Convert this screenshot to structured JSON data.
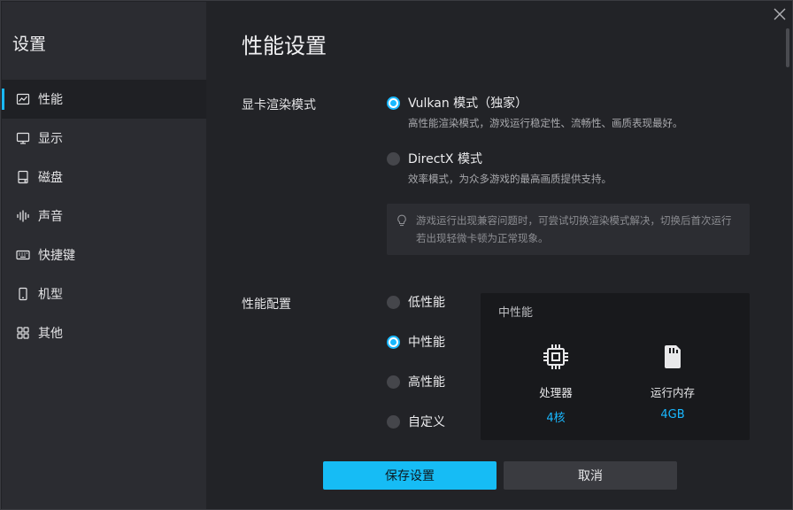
{
  "sidebar": {
    "title": "设置",
    "items": [
      {
        "label": "性能",
        "icon": "chart-icon",
        "active": true
      },
      {
        "label": "显示",
        "icon": "monitor-icon",
        "active": false
      },
      {
        "label": "磁盘",
        "icon": "disk-icon",
        "active": false
      },
      {
        "label": "声音",
        "icon": "sound-icon",
        "active": false
      },
      {
        "label": "快捷键",
        "icon": "keyboard-icon",
        "active": false
      },
      {
        "label": "机型",
        "icon": "phone-icon",
        "active": false
      },
      {
        "label": "其他",
        "icon": "grid-icon",
        "active": false
      }
    ]
  },
  "main": {
    "title": "性能设置",
    "render": {
      "label": "显卡渲染模式",
      "options": [
        {
          "label": "Vulkan 模式（独家）",
          "desc": "高性能渲染模式，游戏运行稳定性、流畅性、画质表现最好。",
          "selected": true
        },
        {
          "label": "DirectX 模式",
          "desc": "效率模式，为众多游戏的最高画质提供支持。",
          "selected": false
        }
      ],
      "tip": "游戏运行出现兼容问题时，可尝试切换渲染模式解决，切换后首次运行若出现轻微卡顿为正常现象。"
    },
    "perf": {
      "label": "性能配置",
      "options": [
        {
          "label": "低性能",
          "selected": false
        },
        {
          "label": "中性能",
          "selected": true
        },
        {
          "label": "高性能",
          "selected": false
        },
        {
          "label": "自定义",
          "selected": false
        }
      ],
      "card": {
        "title": "中性能",
        "cpu": {
          "label": "处理器",
          "value": "4核"
        },
        "ram": {
          "label": "运行内存",
          "value": "4GB"
        }
      }
    },
    "buttons": {
      "save": "保存设置",
      "cancel": "取消"
    }
  },
  "colors": {
    "accent": "#19b8ff",
    "sidebar_bg": "#2b2c31",
    "main_bg": "#222327",
    "card_bg": "#18191c"
  }
}
